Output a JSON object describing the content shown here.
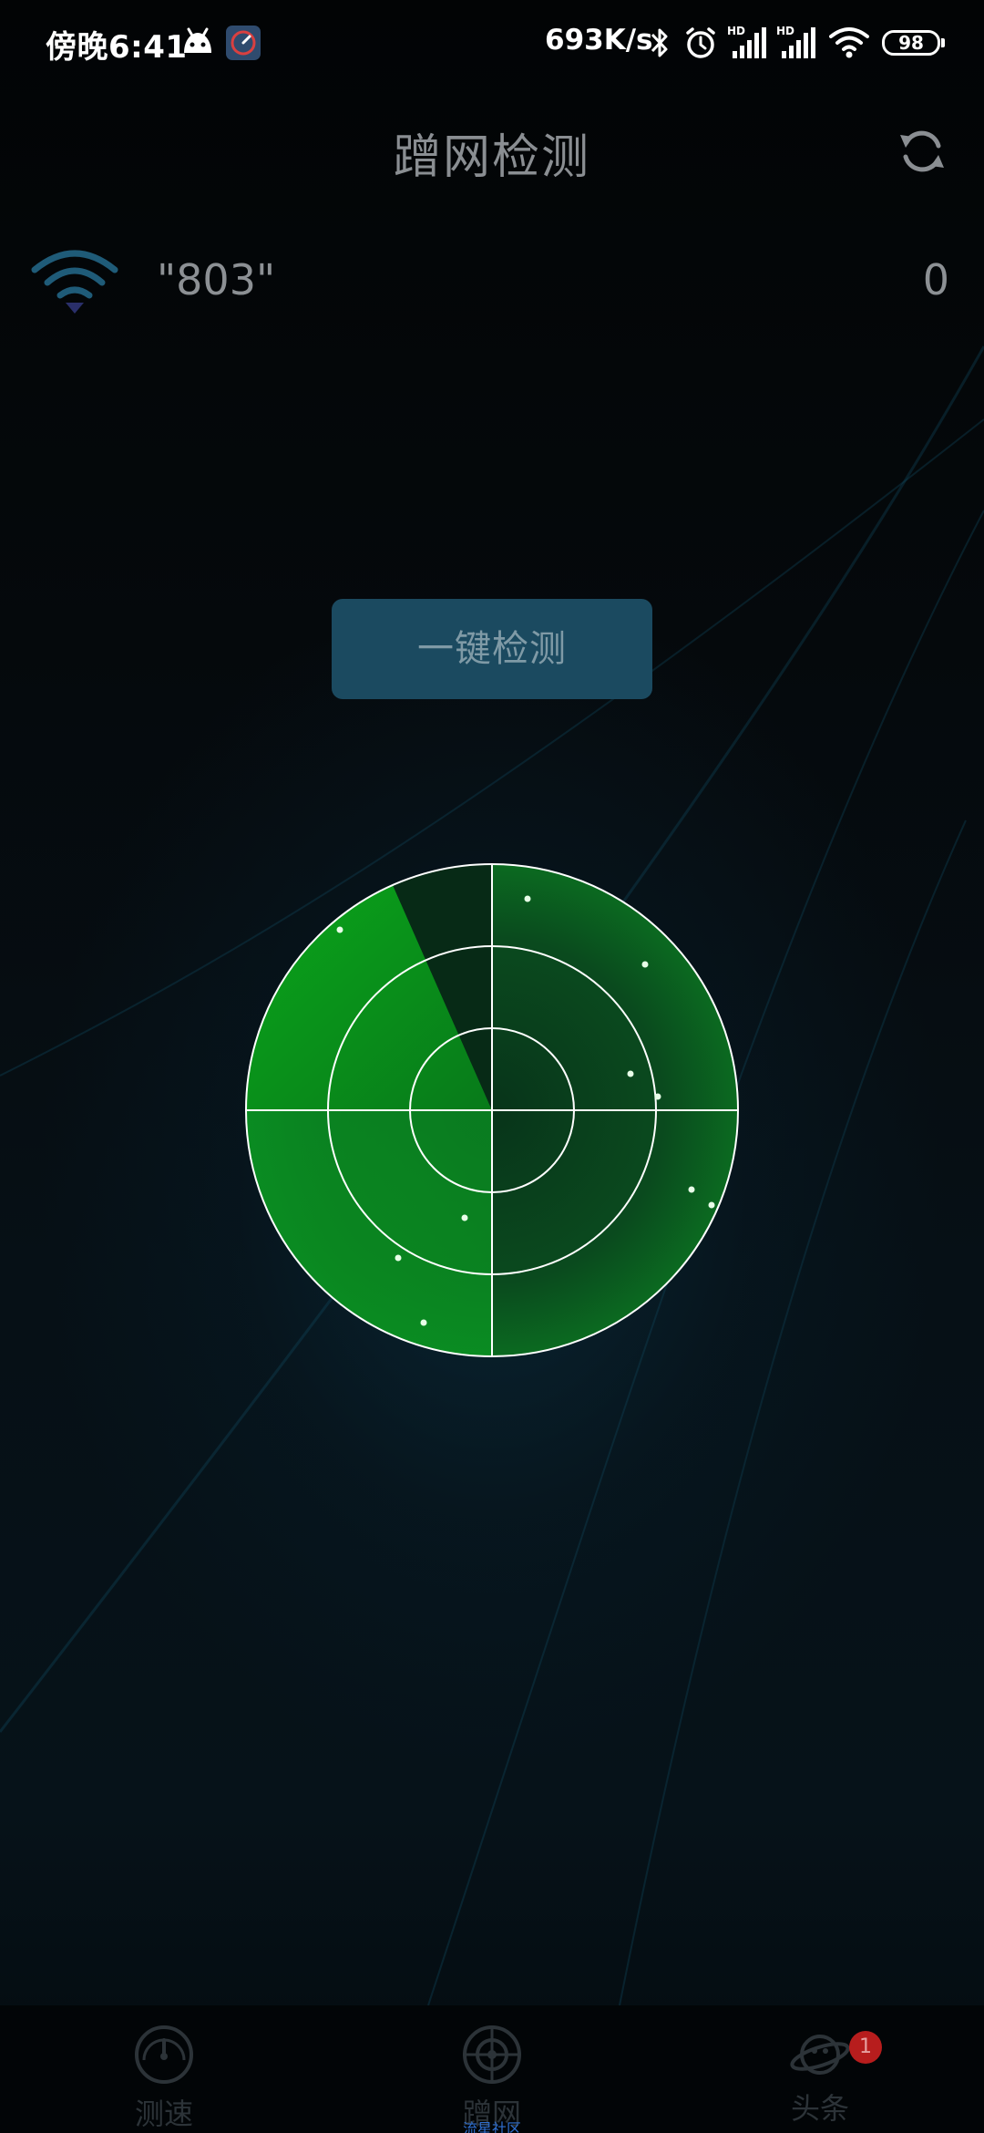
{
  "status_bar": {
    "time": "傍晚6:41",
    "net_speed": "693K/s",
    "battery": "98",
    "icons": [
      "android-icon",
      "speedometer-app-icon",
      "bluetooth-icon",
      "alarm-icon",
      "hd-signal-icon",
      "hd-signal-icon",
      "wifi-icon"
    ]
  },
  "header": {
    "title": "蹭网检测",
    "refresh_icon": "refresh-icon"
  },
  "network": {
    "ssid": "\"803\"",
    "device_count": "0",
    "icon": "wifi-icon"
  },
  "scan_button": {
    "label": "一键检测"
  },
  "radar": {
    "icon": "radar-icon",
    "colors": {
      "sweep": "#0aa51a",
      "ring": "#ffffff",
      "dot": "#dfffe0"
    }
  },
  "bottom_nav": {
    "items": [
      {
        "label": "测速",
        "icon": "speedometer-icon",
        "active": false
      },
      {
        "label": "蹭网",
        "sub_label": "流星社区",
        "icon": "radar-target-icon",
        "active": true
      },
      {
        "label": "头条",
        "icon": "planet-icon",
        "badge": "1",
        "active": false
      }
    ]
  }
}
